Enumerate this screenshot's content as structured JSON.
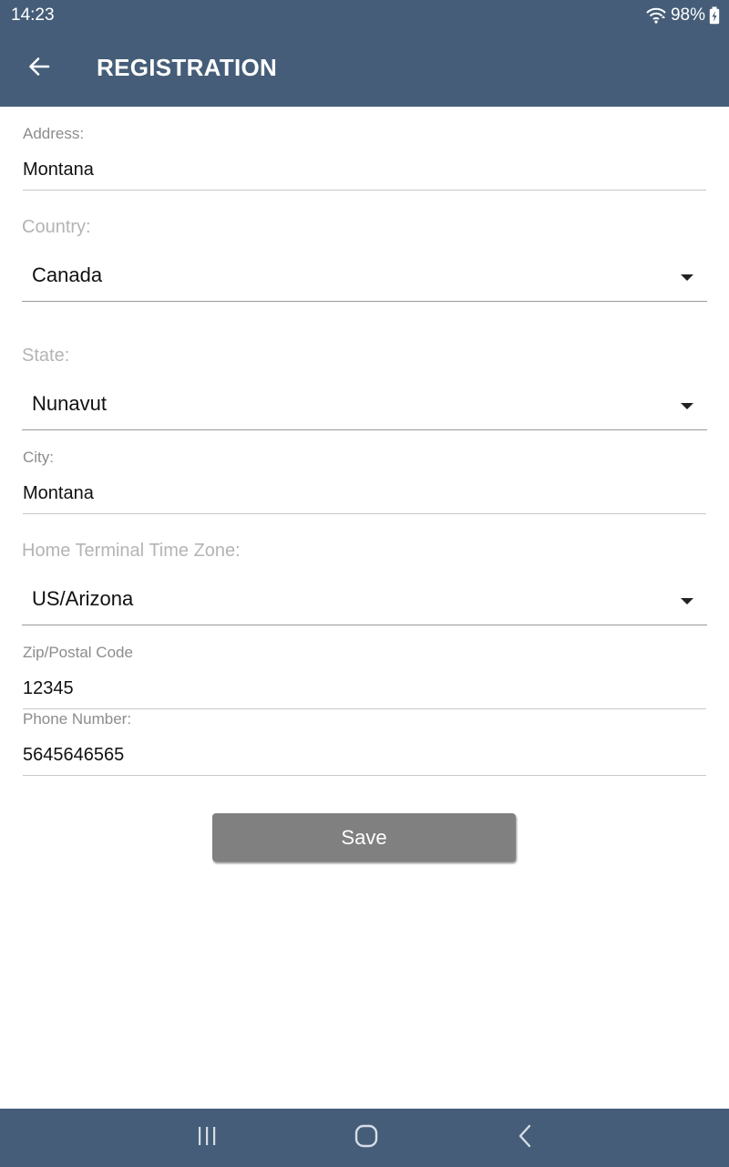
{
  "status_bar": {
    "time": "14:23",
    "battery": "98%",
    "icons": [
      "wifi-icon",
      "battery-charging-icon"
    ]
  },
  "app_bar": {
    "title": "REGISTRATION",
    "back_icon": "arrow-left-icon"
  },
  "form": {
    "address": {
      "label": "Address:",
      "value": "Montana"
    },
    "country": {
      "label": "Country:",
      "value": "Canada"
    },
    "state": {
      "label": "State:",
      "value": "Nunavut"
    },
    "city": {
      "label": "City:",
      "value": "Montana"
    },
    "timezone": {
      "label": "Home Terminal Time Zone:",
      "value": "US/Arizona"
    },
    "zip": {
      "label": "Zip/Postal Code",
      "value": "12345"
    },
    "phone": {
      "label": "Phone Number:",
      "value": "5645646565"
    },
    "save_label": "Save"
  },
  "nav_bar": {
    "icons": [
      "recent-apps-icon",
      "home-icon",
      "back-icon"
    ]
  },
  "colors": {
    "bar_background": "#455d78",
    "button_background": "#808080"
  }
}
